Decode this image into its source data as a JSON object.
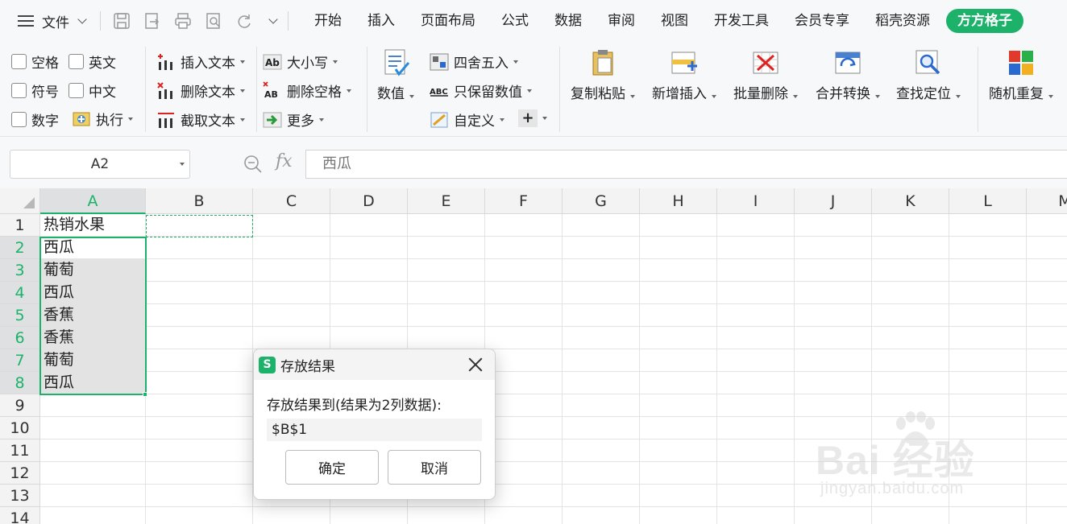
{
  "menubar": {
    "file_label": "文件",
    "tabs": [
      "开始",
      "插入",
      "页面布局",
      "公式",
      "数据",
      "审阅",
      "视图",
      "开发工具",
      "会员专享",
      "稻壳资源",
      "方方格子"
    ]
  },
  "ribbon": {
    "checkbox_space": "空格",
    "checkbox_english": "英文",
    "checkbox_symbol": "符号",
    "checkbox_chinese": "中文",
    "checkbox_number": "数字",
    "execute": "执行",
    "insert_text": "插入文本",
    "delete_text": "删除文本",
    "extract_text": "截取文本",
    "case": "大小写",
    "delete_space": "删除空格",
    "more": "更多",
    "numeric": "数值",
    "round": "四舍五入",
    "keep_numeric": "只保留数值",
    "custom": "自定义",
    "copy_paste": "复制粘贴",
    "add_insert": "新增插入",
    "batch_delete": "批量删除",
    "merge_convert": "合并转换",
    "find_locate": "查找定位",
    "random_repeat": "随机重复"
  },
  "formula_bar": {
    "cell_ref": "A2",
    "fx": "fx",
    "content": "西瓜"
  },
  "sheet": {
    "columns": [
      "A",
      "B",
      "C",
      "D",
      "E",
      "F",
      "G",
      "H",
      "I",
      "J",
      "K",
      "L",
      "M"
    ],
    "rows": [
      "1",
      "2",
      "3",
      "4",
      "5",
      "6",
      "7",
      "8",
      "9",
      "10",
      "11",
      "12",
      "13",
      "14"
    ],
    "a_column": [
      "热销水果",
      "西瓜",
      "葡萄",
      "西瓜",
      "香蕉",
      "香蕉",
      "葡萄",
      "西瓜"
    ]
  },
  "dialog": {
    "logo": "S",
    "title": "存放结果",
    "prompt": "存放结果到(结果为2列数据):",
    "value": "$B$1",
    "ok": "确定",
    "cancel": "取消"
  },
  "watermark": {
    "main": "Bai 经验",
    "sub": "jingyan.baidu.com"
  },
  "colors": {
    "accent": "#1db26a",
    "ribbon_bg": "#f7f8fa",
    "selected_fill": "#e3e3e3"
  }
}
